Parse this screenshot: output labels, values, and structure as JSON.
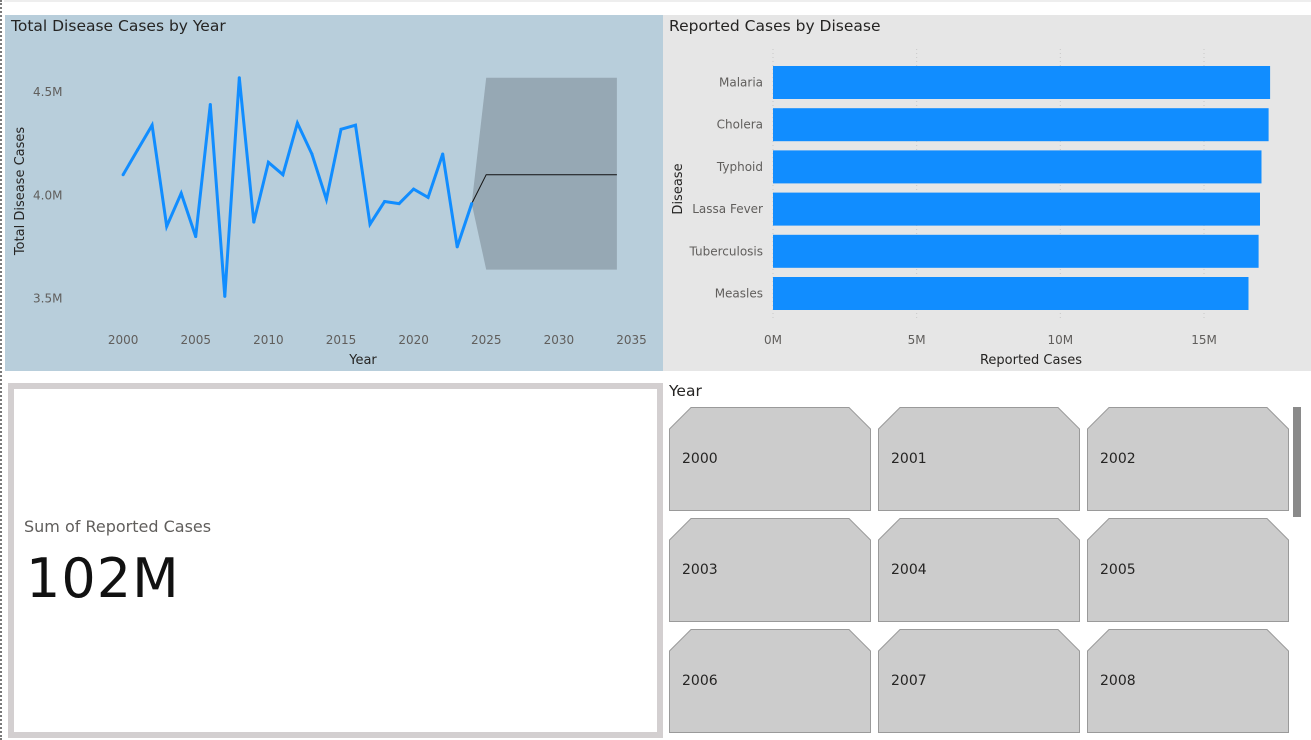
{
  "line_chart": {
    "title": "Total Disease Cases by Year",
    "colors": {
      "background": "#b8cedb",
      "line": "#118dff",
      "forecast_band": "#96a8b4",
      "forecast_line": "#111111"
    },
    "chart_data": {
      "type": "line",
      "title": "Total Disease Cases by Year",
      "xlabel": "Year",
      "ylabel": "Total Disease Cases",
      "x_ticks": [
        "2000",
        "2005",
        "2010",
        "2015",
        "2020",
        "2025",
        "2030",
        "2035"
      ],
      "y_ticks": [
        "3.5M",
        "4.0M",
        "4.5M"
      ],
      "xlim": [
        1996,
        2036
      ],
      "ylim": [
        3.42,
        4.68
      ],
      "y_unit": "M",
      "series": [
        {
          "x": [
            2000,
            2001,
            2002,
            2003,
            2004,
            2005,
            2006,
            2007,
            2008,
            2009,
            2010,
            2011,
            2012,
            2013,
            2014,
            2015,
            2016,
            2017,
            2018,
            2019,
            2020,
            2021,
            2022,
            2023,
            2024
          ],
          "y": [
            4.1,
            4.22,
            4.34,
            3.85,
            4.01,
            3.8,
            4.44,
            3.51,
            4.57,
            3.87,
            4.16,
            4.1,
            4.35,
            4.2,
            3.98,
            4.32,
            4.34,
            3.86,
            3.97,
            3.96,
            4.03,
            3.99,
            4.2,
            3.75,
            3.96
          ]
        }
      ],
      "forecast": {
        "x": [
          2024,
          2025,
          2034
        ],
        "y": [
          3.96,
          4.1,
          4.1
        ],
        "upper": [
          3.96,
          4.57,
          4.57
        ],
        "lower": [
          3.96,
          3.64,
          3.64
        ]
      },
      "grid": false,
      "legend": "none"
    }
  },
  "bar_chart": {
    "title": "Reported Cases by Disease",
    "colors": {
      "background": "#e6e6e6",
      "bar": "#118dff",
      "grid": "#c8c8c8"
    },
    "chart_data": {
      "type": "bar",
      "orientation": "horizontal",
      "title": "Reported Cases by Disease",
      "xlabel": "Reported Cases",
      "ylabel": "Disease",
      "categories": [
        "Malaria",
        "Cholera",
        "Typhoid",
        "Lassa Fever",
        "Tuberculosis",
        "Measles"
      ],
      "values": [
        17.3,
        17.25,
        17.0,
        16.95,
        16.9,
        16.55
      ],
      "value_unit": "M",
      "x_ticks": [
        "0M",
        "5M",
        "10M",
        "15M"
      ],
      "xlim": [
        0,
        17.5
      ],
      "grid": true,
      "legend": "none"
    }
  },
  "card": {
    "label": "Sum of Reported Cases",
    "value": "102M"
  },
  "slicer": {
    "header": "Year",
    "items": [
      "2000",
      "2001",
      "2002",
      "2003",
      "2004",
      "2005",
      "2006",
      "2007",
      "2008"
    ]
  }
}
